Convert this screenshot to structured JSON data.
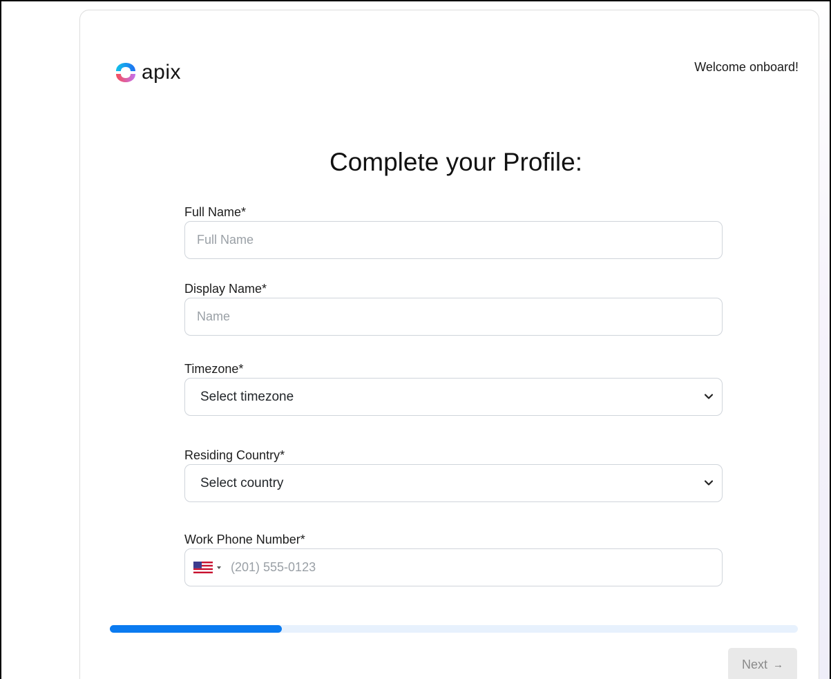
{
  "brand": {
    "name": "apix",
    "logo_icon": "apix-logo-icon",
    "logo_colors": [
      "#12c2e9",
      "#1f6ff2",
      "#c471ed",
      "#f64f59"
    ]
  },
  "header": {
    "welcome_text": "Welcome onboard!"
  },
  "page": {
    "title": "Complete your Profile:"
  },
  "form": {
    "full_name": {
      "label": "Full Name*",
      "placeholder": "Full Name",
      "value": ""
    },
    "display_name": {
      "label": "Display Name*",
      "placeholder": "Name",
      "value": ""
    },
    "timezone": {
      "label": "Timezone*",
      "selected": "Select timezone",
      "icon": "chevron-down-icon"
    },
    "country": {
      "label": "Residing Country*",
      "selected": "Select country",
      "icon": "chevron-down-icon"
    },
    "phone": {
      "label": "Work Phone Number*",
      "placeholder": "(201) 555-0123",
      "country_flag": "us-flag-icon",
      "value": ""
    }
  },
  "progress": {
    "fraction": 0.25,
    "fill_color": "#0b7bf0",
    "track_color": "#e7f1fd"
  },
  "footer": {
    "next_label": "Next",
    "next_icon": "arrow-right-icon",
    "next_arrow_glyph": "→"
  }
}
